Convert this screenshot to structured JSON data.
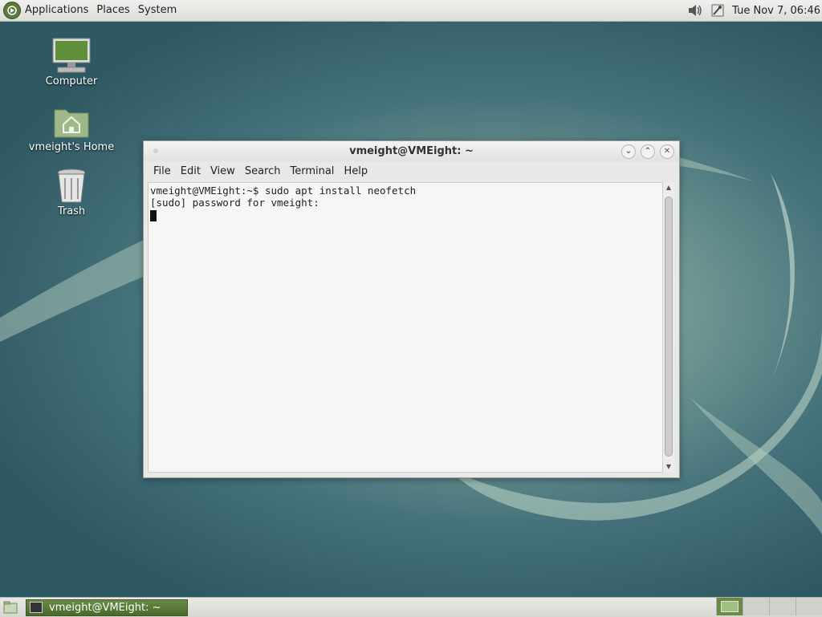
{
  "top_panel": {
    "menus": [
      "Applications",
      "Places",
      "System"
    ],
    "clock": "Tue Nov  7, 06:46",
    "tray_icons": [
      "volume-icon",
      "network-icon"
    ]
  },
  "desktop": {
    "icons": [
      {
        "label": "Computer",
        "icon": "computer-icon"
      },
      {
        "label": "vmeight's Home",
        "icon": "home-folder-icon"
      },
      {
        "label": "Trash",
        "icon": "trash-icon"
      }
    ]
  },
  "terminal": {
    "title": "vmeight@VMEight: ~",
    "menus": [
      "File",
      "Edit",
      "View",
      "Search",
      "Terminal",
      "Help"
    ],
    "lines": [
      "vmeight@VMEight:~$ sudo apt install neofetch",
      "[sudo] password for vmeight:"
    ]
  },
  "bottom_panel": {
    "task_label": "vmeight@VMEight: ~",
    "workspace_count": 4,
    "active_workspace": 1
  },
  "colors": {
    "accent": "#5b7a3a",
    "wallpaper": "#3d6a72"
  }
}
